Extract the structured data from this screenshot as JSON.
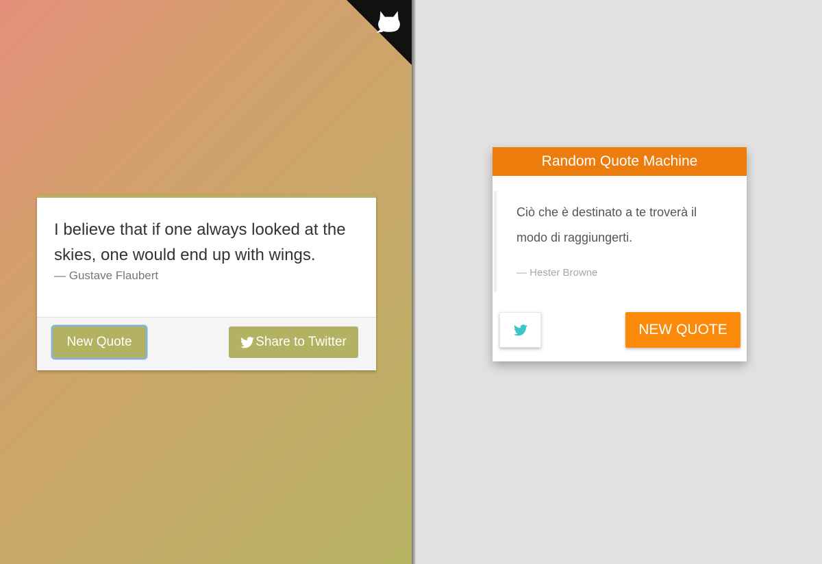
{
  "left_app": {
    "quote": "I believe that if one always looked at the skies, one would end up with wings.",
    "author": "— Gustave Flaubert",
    "new_quote_label": "New Quote",
    "share_label": "Share to Twitter",
    "accent_color": "#b3b262",
    "corner_icon": "github-icon"
  },
  "right_app": {
    "title": "Random Quote Machine",
    "quote": "Ciò che è destinato a te troverà il modo di raggiungerti.",
    "author": "— Hester Browne",
    "new_quote_label": "NEW QUOTE",
    "tweet_icon": "twitter-icon",
    "header_color": "#ec7c0c",
    "button_color": "#fb8a0a",
    "twitter_color": "#38c6c9"
  }
}
